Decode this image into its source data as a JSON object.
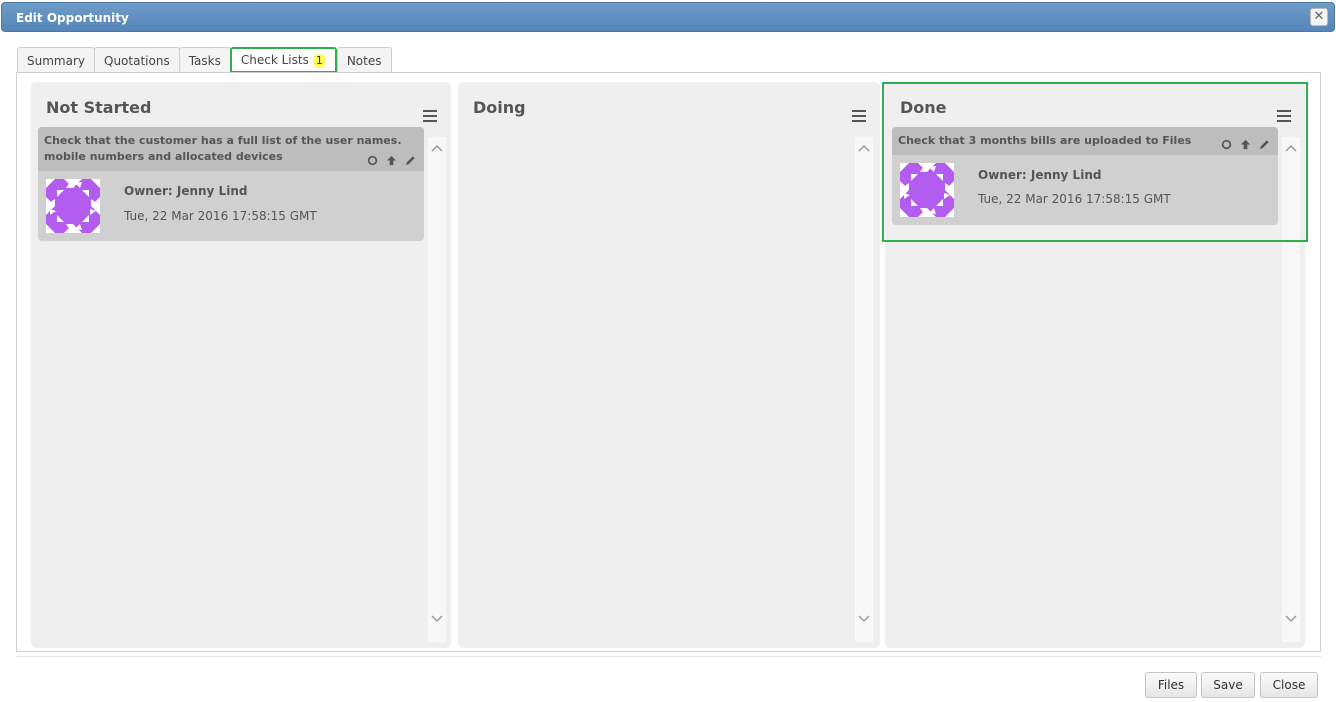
{
  "window": {
    "title": "Edit Opportunity"
  },
  "tabs": [
    {
      "label": "Summary"
    },
    {
      "label": "Quotations"
    },
    {
      "label": "Tasks"
    },
    {
      "label": "Check Lists",
      "badge": "1",
      "active": true
    },
    {
      "label": "Notes"
    }
  ],
  "columns": {
    "not_started": {
      "title": "Not Started",
      "card": {
        "text": "Check that the customer has a full list of the user names. mobile numbers and allocated devices",
        "owner": "Owner: Jenny Lind",
        "date": "Tue, 22 Mar 2016 17:58:15 GMT"
      }
    },
    "doing": {
      "title": "Doing"
    },
    "done": {
      "title": "Done",
      "card": {
        "text": "Check that 3 months bills are uploaded to Files",
        "owner": "Owner: Jenny Lind",
        "date": "Tue, 22 Mar 2016 17:58:15 GMT"
      }
    }
  },
  "footer": {
    "files_label": "Files",
    "save_label": "Save",
    "close_label": "Close"
  },
  "colors": {
    "titlebar": "#5a8bbd",
    "active_tab_outline": "#2eb04f",
    "badge": "#fff95a",
    "avatar": "#b35cf0"
  }
}
